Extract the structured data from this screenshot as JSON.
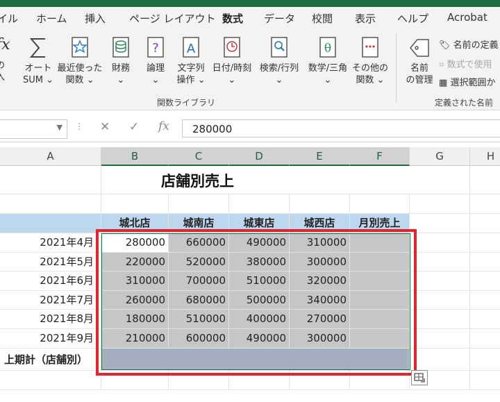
{
  "tabs": [
    "イル",
    "ホーム",
    "挿入",
    "ページ レイアウト",
    "数式",
    "データ",
    "校閲",
    "表示",
    "ヘルプ",
    "Acrobat"
  ],
  "active_tab": "数式",
  "ribbon": {
    "insert_func_partial": [
      "fx",
      "の",
      "入"
    ],
    "autosum": [
      "オート",
      "SUM ⌄"
    ],
    "recent": [
      "最近使った",
      "関数 ⌄"
    ],
    "financial": [
      "財務",
      "⌄"
    ],
    "logical": [
      "論理",
      "⌄"
    ],
    "text": [
      "文字列",
      "操作 ⌄"
    ],
    "datetime": [
      "日付/時刻",
      "⌄"
    ],
    "lookup": [
      "検索/行列",
      "⌄"
    ],
    "math": [
      "数学/三角",
      "⌄"
    ],
    "other": [
      "その他の",
      "関数 ⌄"
    ],
    "library_label": "関数ライブラリ",
    "name_manager": [
      "名前",
      "の管理"
    ],
    "define_name": "名前の定義",
    "use_in_formula": "数式で使用",
    "create_from_selection": "選択範囲か",
    "defined_names_label": "定義された名前"
  },
  "formula_bar": {
    "name_box": "",
    "cancel": "✕",
    "enter": "✓",
    "fx": "fx",
    "value": "280000"
  },
  "columns": [
    "A",
    "B",
    "C",
    "D",
    "E",
    "F",
    "G",
    "H"
  ],
  "sheet": {
    "title": "店舗別売上",
    "headers": [
      "城北店",
      "城南店",
      "城東店",
      "城西店",
      "月別売上"
    ],
    "rows": [
      {
        "month": "2021年4月",
        "values": [
          "280000",
          "660000",
          "490000",
          "310000"
        ]
      },
      {
        "month": "2021年5月",
        "values": [
          "220000",
          "520000",
          "380000",
          "300000"
        ]
      },
      {
        "month": "2021年6月",
        "values": [
          "310000",
          "700000",
          "510000",
          "320000"
        ]
      },
      {
        "month": "2021年7月",
        "values": [
          "260000",
          "680000",
          "500000",
          "340000"
        ]
      },
      {
        "month": "2021年8月",
        "values": [
          "180000",
          "510000",
          "400000",
          "270000"
        ]
      },
      {
        "month": "2021年9月",
        "values": [
          "210000",
          "600000",
          "490000",
          "300000"
        ]
      }
    ],
    "total_label": "上期計（店舗別）"
  },
  "colors": {
    "excel_green": "#1f6e43",
    "highlight_red": "#e0262d",
    "header_band": "#bdd7ee",
    "selection_shade": "#c6c6c6"
  }
}
